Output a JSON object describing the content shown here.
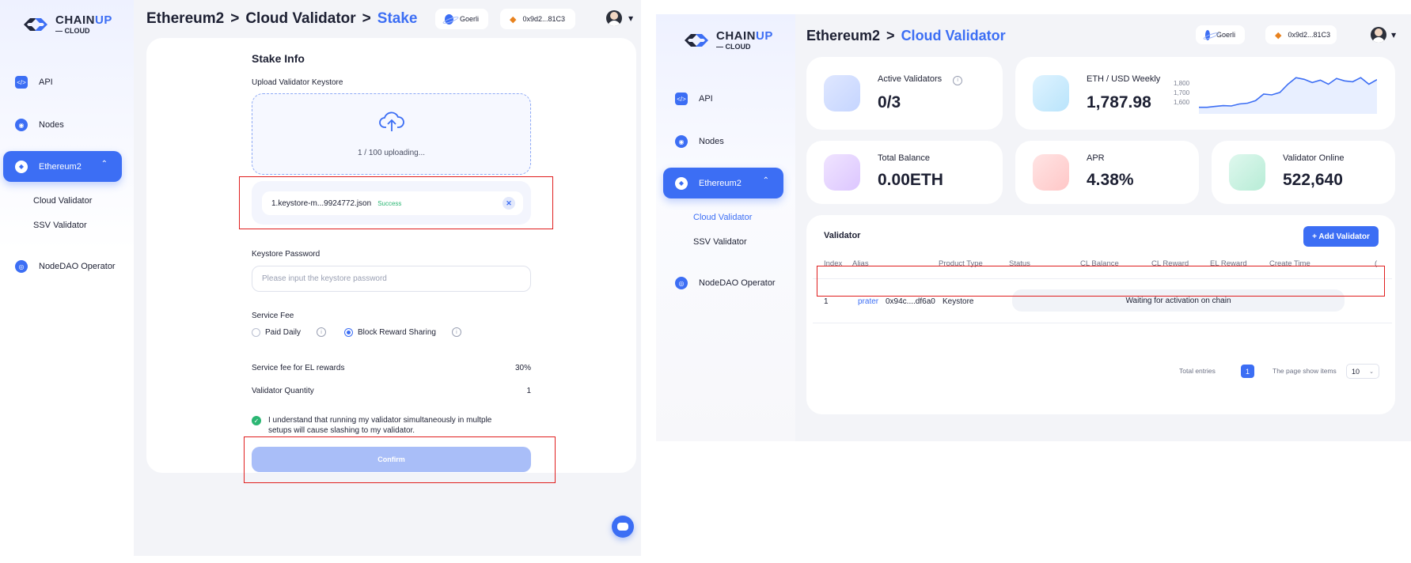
{
  "left": {
    "brand": {
      "name_part1": "CHAIN",
      "name_part2": "UP",
      "sub": "— CLOUD"
    },
    "nav": [
      {
        "label": "API",
        "icon": "code-icon"
      },
      {
        "label": "Nodes",
        "icon": "nodes-icon"
      },
      {
        "label": "Ethereum2",
        "icon": "ethereum-icon",
        "active": true
      },
      {
        "label": "NodeDAO Operator",
        "icon": "nodedao-icon"
      }
    ],
    "subnav": [
      "Cloud Validator",
      "SSV Validator"
    ],
    "breadcrumb": {
      "part1": "Ethereum2",
      "sep": ">",
      "part2": "Cloud Validator",
      "current": "Stake"
    },
    "network": "Goerli",
    "wallet": "0x9d2...81C3",
    "form": {
      "title": "Stake Info",
      "upload_label": "Upload Validator Keystore",
      "upload_status": "1 / 100 uploading...",
      "file_name": "1.keystore-m...9924772.json",
      "file_status": "Success",
      "password_label": "Keystore Password",
      "password_placeholder": "Please input the keystore password",
      "fee_label": "Service Fee",
      "fee_option1": "Paid Daily",
      "fee_option2": "Block Reward Sharing",
      "el_fee_label": "Service fee for EL rewards",
      "el_fee_value": "30%",
      "qty_label": "Validator Quantity",
      "qty_value": "1",
      "agree_text_1": "I understand that running my validator simultaneously in multple",
      "agree_text_2": "setups will cause slashing to my validator.",
      "confirm_label": "Confirm"
    }
  },
  "right": {
    "brand": {
      "name_part1": "CHAIN",
      "name_part2": "UP",
      "sub": "— CLOUD"
    },
    "nav": [
      {
        "label": "API"
      },
      {
        "label": "Nodes"
      },
      {
        "label": "Ethereum2",
        "active": true
      },
      {
        "label": "NodeDAO Operator"
      }
    ],
    "subnav": [
      "Cloud Validator",
      "SSV Validator"
    ],
    "breadcrumb": {
      "part1": "Ethereum2",
      "sep": ">",
      "current": "Cloud Validator"
    },
    "network": "Goerli",
    "wallet": "0x9d2...81C3",
    "stats": {
      "active_label": "Active Validators",
      "active_value": "0/3",
      "eth_label": "ETH / USD Weekly",
      "eth_value": "1,787.98",
      "eth_ticks": [
        "1,800",
        "1,700",
        "1,600"
      ],
      "balance_label": "Total Balance",
      "balance_value": "0.00ETH",
      "apr_label": "APR",
      "apr_value": "4.38%",
      "online_label": "Validator Online",
      "online_value": "522,640"
    },
    "chart_data": {
      "type": "line",
      "values": [
        1620,
        1620,
        1625,
        1630,
        1628,
        1640,
        1645,
        1660,
        1700,
        1695,
        1710,
        1760,
        1800,
        1790,
        1770,
        1785,
        1760,
        1795,
        1780,
        1775,
        1800,
        1760,
        1788
      ],
      "ylim": [
        1580,
        1820
      ],
      "y_ticks": [
        1800,
        1700,
        1600
      ]
    },
    "table": {
      "title": "Validator",
      "add_label": "+ Add Validator",
      "headers": [
        "Index",
        "Alias",
        "Product Type",
        "Status",
        "CL Balance",
        "CL Reward",
        "EL Reward",
        "Create Time",
        "("
      ],
      "rows": [
        {
          "index": "1",
          "alias": "prater",
          "address": "0x94c....df6a0",
          "type": "Keystore",
          "status": "Waiting for activation on chain"
        }
      ],
      "total_label": "Total entries",
      "page": "1",
      "page_size_label": "The page show items",
      "page_size": "10"
    }
  }
}
